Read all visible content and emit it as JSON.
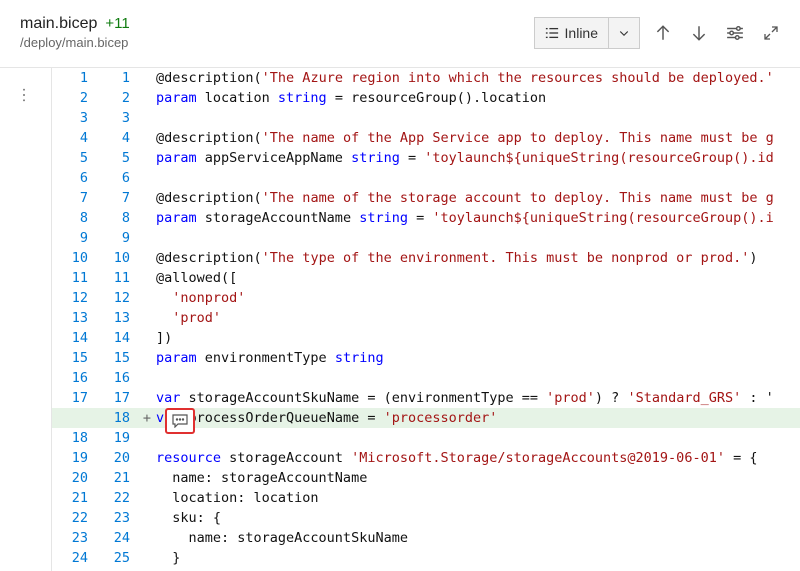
{
  "header": {
    "file_name": "main.bicep",
    "diff_badge": "+11",
    "file_path": "/deploy/main.bicep",
    "view_mode": "Inline"
  },
  "lines": [
    {
      "old": "1",
      "new": "1",
      "sign": " ",
      "added": false,
      "tokens": [
        [
          "plain",
          "@description("
        ],
        [
          "str",
          "'The Azure region into which the resources should be deployed.'"
        ]
      ]
    },
    {
      "old": "2",
      "new": "2",
      "sign": " ",
      "added": false,
      "tokens": [
        [
          "kw",
          "param"
        ],
        [
          "plain",
          " location "
        ],
        [
          "kw",
          "string"
        ],
        [
          "plain",
          " = resourceGroup().location"
        ]
      ]
    },
    {
      "old": "3",
      "new": "3",
      "sign": " ",
      "added": false,
      "tokens": []
    },
    {
      "old": "4",
      "new": "4",
      "sign": " ",
      "added": false,
      "tokens": [
        [
          "plain",
          "@description("
        ],
        [
          "str",
          "'The name of the App Service app to deploy. This name must be g"
        ]
      ]
    },
    {
      "old": "5",
      "new": "5",
      "sign": " ",
      "added": false,
      "tokens": [
        [
          "kw",
          "param"
        ],
        [
          "plain",
          " appServiceAppName "
        ],
        [
          "kw",
          "string"
        ],
        [
          "plain",
          " = "
        ],
        [
          "str",
          "'toylaunch${uniqueString(resourceGroup().id"
        ]
      ]
    },
    {
      "old": "6",
      "new": "6",
      "sign": " ",
      "added": false,
      "tokens": []
    },
    {
      "old": "7",
      "new": "7",
      "sign": " ",
      "added": false,
      "tokens": [
        [
          "plain",
          "@description("
        ],
        [
          "str",
          "'The name of the storage account to deploy. This name must be g"
        ]
      ]
    },
    {
      "old": "8",
      "new": "8",
      "sign": " ",
      "added": false,
      "tokens": [
        [
          "kw",
          "param"
        ],
        [
          "plain",
          " storageAccountName "
        ],
        [
          "kw",
          "string"
        ],
        [
          "plain",
          " = "
        ],
        [
          "str",
          "'toylaunch${uniqueString(resourceGroup().i"
        ]
      ]
    },
    {
      "old": "9",
      "new": "9",
      "sign": " ",
      "added": false,
      "tokens": []
    },
    {
      "old": "10",
      "new": "10",
      "sign": " ",
      "added": false,
      "tokens": [
        [
          "plain",
          "@description("
        ],
        [
          "str",
          "'The type of the environment. This must be nonprod or prod.'"
        ],
        [
          "plain",
          ")"
        ]
      ]
    },
    {
      "old": "11",
      "new": "11",
      "sign": " ",
      "added": false,
      "tokens": [
        [
          "plain",
          "@allowed(["
        ]
      ]
    },
    {
      "old": "12",
      "new": "12",
      "sign": " ",
      "added": false,
      "tokens": [
        [
          "plain",
          "  "
        ],
        [
          "str",
          "'nonprod'"
        ]
      ]
    },
    {
      "old": "13",
      "new": "13",
      "sign": " ",
      "added": false,
      "tokens": [
        [
          "plain",
          "  "
        ],
        [
          "str",
          "'prod'"
        ]
      ]
    },
    {
      "old": "14",
      "new": "14",
      "sign": " ",
      "added": false,
      "tokens": [
        [
          "plain",
          "])"
        ]
      ]
    },
    {
      "old": "15",
      "new": "15",
      "sign": " ",
      "added": false,
      "tokens": [
        [
          "kw",
          "param"
        ],
        [
          "plain",
          " environmentType "
        ],
        [
          "kw",
          "string"
        ]
      ]
    },
    {
      "old": "16",
      "new": "16",
      "sign": " ",
      "added": false,
      "tokens": []
    },
    {
      "old": "17",
      "new": "17",
      "sign": " ",
      "added": false,
      "tokens": [
        [
          "kw",
          "var"
        ],
        [
          "plain",
          " storageAccountSkuName = (environmentType == "
        ],
        [
          "str",
          "'prod'"
        ],
        [
          "plain",
          ") ? "
        ],
        [
          "str",
          "'Standard_GRS'"
        ],
        [
          "plain",
          " : '"
        ]
      ]
    },
    {
      "old": "",
      "new": "18",
      "sign": "+",
      "added": true,
      "tokens": [
        [
          "kw",
          "var"
        ],
        [
          "plain",
          " processOrderQueueName = "
        ],
        [
          "str",
          "'processorder'"
        ]
      ]
    },
    {
      "old": "18",
      "new": "19",
      "sign": " ",
      "added": false,
      "tokens": []
    },
    {
      "old": "19",
      "new": "20",
      "sign": " ",
      "added": false,
      "tokens": [
        [
          "kw",
          "resource"
        ],
        [
          "plain",
          " storageAccount "
        ],
        [
          "str",
          "'Microsoft.Storage/storageAccounts@2019-06-01'"
        ],
        [
          "plain",
          " = {"
        ]
      ]
    },
    {
      "old": "20",
      "new": "21",
      "sign": " ",
      "added": false,
      "tokens": [
        [
          "plain",
          "  name: storageAccountName"
        ]
      ]
    },
    {
      "old": "21",
      "new": "22",
      "sign": " ",
      "added": false,
      "tokens": [
        [
          "plain",
          "  location: location"
        ]
      ]
    },
    {
      "old": "22",
      "new": "23",
      "sign": " ",
      "added": false,
      "tokens": [
        [
          "plain",
          "  sku: {"
        ]
      ]
    },
    {
      "old": "23",
      "new": "24",
      "sign": " ",
      "added": false,
      "tokens": [
        [
          "plain",
          "    name: storageAccountSkuName"
        ]
      ]
    },
    {
      "old": "24",
      "new": "25",
      "sign": " ",
      "added": false,
      "tokens": [
        [
          "plain",
          "  }"
        ]
      ]
    }
  ]
}
